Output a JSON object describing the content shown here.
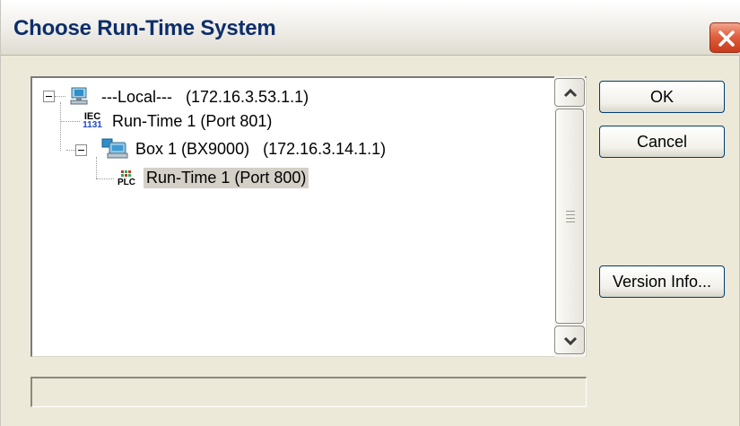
{
  "window": {
    "title": "Choose Run-Time System"
  },
  "tree": {
    "nodes": [
      {
        "label": "---Local---   (172.16.3.53.1.1)",
        "icon": "network-pc-icon",
        "expanded": true
      },
      {
        "label": "Run-Time 1 (Port 801)",
        "icon": "iec-1131-icon"
      },
      {
        "label": "Box 1 (BX9000)   (172.16.3.14.1.1)",
        "icon": "network-box-icon",
        "expanded": true
      },
      {
        "label": "Run-Time 1 (Port 800)",
        "icon": "plc-icon",
        "selected": true
      }
    ],
    "iec_text": "IEC",
    "iec_num": "1131",
    "plc_text": "PLC"
  },
  "buttons": {
    "ok": "OK",
    "cancel": "Cancel",
    "version_info": "Version Info..."
  },
  "status": {
    "text": ""
  }
}
